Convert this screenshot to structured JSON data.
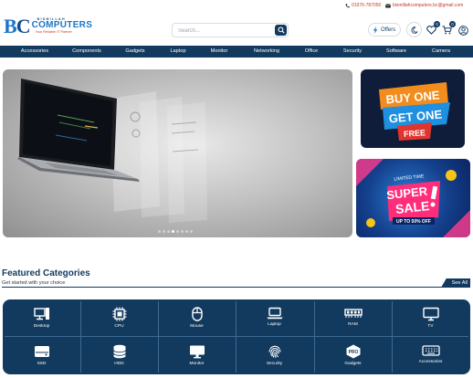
{
  "topbar": {
    "phone": "01976-787050",
    "email": "bismillahcomputers.bc@gmail.com",
    "phone_icon": "phone-icon",
    "email_icon": "envelope-icon"
  },
  "brand": {
    "letters_left": "B",
    "letters_right": "C",
    "sub": "BISMILLAH",
    "name": "COMPUTERS",
    "tagline": "Your Reliable IT Partner"
  },
  "search": {
    "placeholder": "Search..."
  },
  "header": {
    "offers_label": "Offers",
    "wishlist_count": "0",
    "cart_count": "0"
  },
  "nav": {
    "items": [
      "Accessories",
      "Components",
      "Gadgets",
      "Laptop",
      "Monitor",
      "Networking",
      "Office",
      "Security",
      "Software",
      "Camera"
    ]
  },
  "promos": {
    "promo1": {
      "line1": "BUY ONE",
      "line2": "GET ONE",
      "line3": "FREE"
    },
    "promo2": {
      "tag": "LIMITED TIME",
      "line1": "SUPER",
      "line2": "SALE",
      "line3": "UP TO 50% OFF"
    }
  },
  "carousel": {
    "slide_count": 8,
    "active_index": 3
  },
  "featured": {
    "title": "Featured Categories",
    "subtitle": "Get started with your choice",
    "see_all": "See All",
    "categories": [
      {
        "label": "Desktop",
        "icon": "desktop-icon"
      },
      {
        "label": "CPU",
        "icon": "cpu-icon"
      },
      {
        "label": "Mouse",
        "icon": "mouse-icon"
      },
      {
        "label": "Laptop",
        "icon": "laptop-icon"
      },
      {
        "label": "RAM",
        "icon": "ram-icon"
      },
      {
        "label": "TV",
        "icon": "tv-icon"
      },
      {
        "label": "SSD",
        "icon": "ssd-icon"
      },
      {
        "label": "HDD",
        "icon": "hdd-icon"
      },
      {
        "label": "Monitor",
        "icon": "monitor-icon"
      },
      {
        "label": "Security",
        "icon": "fingerprint-icon"
      },
      {
        "label": "Gadgets",
        "icon": "gadgets-icon"
      },
      {
        "label": "Accessories",
        "icon": "keyboard-icon"
      }
    ]
  },
  "colors": {
    "primary": "#123a5e",
    "accent_red": "#c0392b",
    "brand_blue": "#1a76c8"
  }
}
